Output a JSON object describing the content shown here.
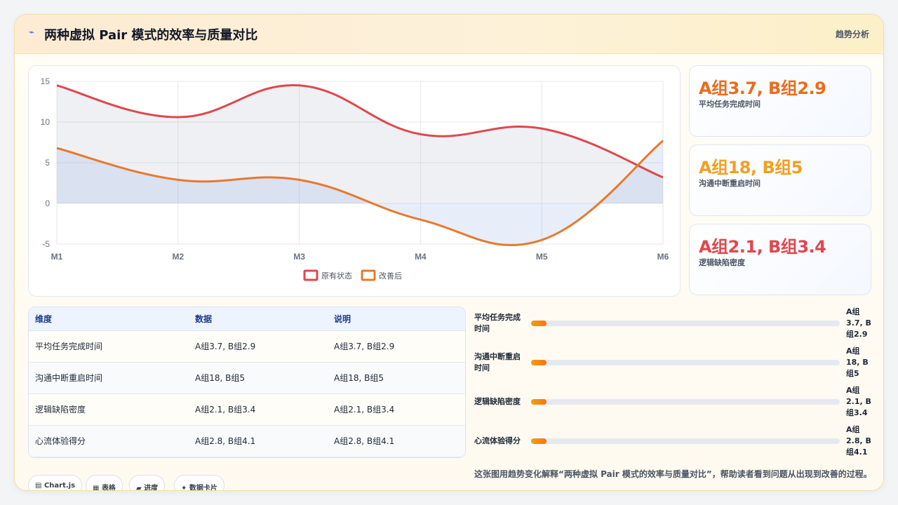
{
  "header": {
    "icon": "trend-icon",
    "title": "两种虚拟 Pair 模式的效率与质量对比",
    "tag": "趋势分析"
  },
  "chart_data": {
    "type": "line",
    "categories": [
      "M1",
      "M2",
      "M3",
      "M4",
      "M5",
      "M6"
    ],
    "series": [
      {
        "name": "原有状态",
        "values": [
          14.5,
          10.6,
          14.5,
          8.5,
          9.2,
          3.2
        ],
        "color": "#e0474c"
      },
      {
        "name": "改善后",
        "values": [
          6.8,
          2.9,
          2.9,
          -2.0,
          -4.5,
          7.7
        ],
        "color": "#e8792b"
      }
    ],
    "ylim": [
      -5,
      15
    ],
    "yticks": [
      15,
      10,
      5,
      0,
      -5
    ],
    "grid": true,
    "legend_position": "bottom",
    "fill": true
  },
  "stats": [
    {
      "value": "A组3.7, B组2.9",
      "label": "平均任务完成时间",
      "color": "#ea6c1e"
    },
    {
      "value": "A组18, B组5",
      "label": "沟通中断重启时间",
      "color": "#f0a020"
    },
    {
      "value": "A组2.1, B组3.4",
      "label": "逻辑缺陷密度",
      "color": "#e0474c"
    }
  ],
  "table": {
    "headers": [
      "维度",
      "数据",
      "说明"
    ],
    "rows": [
      [
        "平均任务完成时间",
        "A组3.7, B组2.9",
        "A组3.7, B组2.9"
      ],
      [
        "沟通中断重启时间",
        "A组18, B组5",
        "A组18, B组5"
      ],
      [
        "逻辑缺陷密度",
        "A组2.1, B组3.4",
        "A组2.1, B组3.4"
      ],
      [
        "心流体验得分",
        "A组2.8, B组4.1",
        "A组2.8, B组4.1"
      ]
    ]
  },
  "progress": [
    {
      "label_line1": "平均任务完成",
      "label_line2": "时间",
      "value_line1": "A组",
      "value_line2": "3.7, B",
      "value_line3": "组2.9",
      "fraction": 0.05
    },
    {
      "label_line1": "沟通中断重启",
      "label_line2": "时间",
      "value_line1": "A组",
      "value_line2": "18, B",
      "value_line3": "组5",
      "fraction": 0.05
    },
    {
      "label_line1": "逻辑缺陷密度",
      "label_line2": "",
      "value_line1": "A组",
      "value_line2": "2.1, B",
      "value_line3": "组3.4",
      "fraction": 0.05
    },
    {
      "label_line1": "心流体验得分",
      "label_line2": "",
      "value_line1": "A组",
      "value_line2": "2.8, B",
      "value_line3": "组4.1",
      "fraction": 0.05
    }
  ],
  "caption": "这张图用趋势变化解释“两种虚拟 Pair 模式的效率与质量对比”，帮助读者看到问题从出现到改善的过程。",
  "chips": [
    {
      "icon": "▤",
      "label": "Chart.js"
    },
    {
      "icon": "▦",
      "label": "表格"
    },
    {
      "icon": "▰",
      "label": "进度"
    },
    {
      "icon": "✦",
      "label": "数据卡片"
    }
  ]
}
